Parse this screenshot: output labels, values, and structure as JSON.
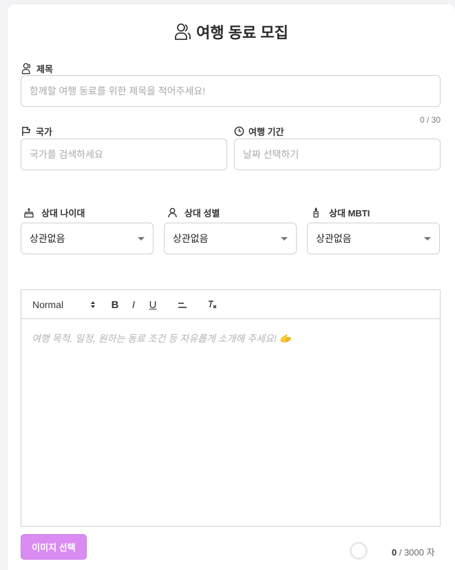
{
  "header": {
    "title": "여행 동료 모집"
  },
  "title_field": {
    "label": "제목",
    "placeholder": "함께할 여행 동료를 위한 제목을 적어주세요!",
    "counter": "0 / 30"
  },
  "country_field": {
    "label": "국가",
    "placeholder": "국가를 검색하세요"
  },
  "period_field": {
    "label": "여행 기간",
    "placeholder": "날짜 선택하기"
  },
  "age_field": {
    "label": "상대 나이대",
    "value": "상관없음"
  },
  "gender_field": {
    "label": "상대 성별",
    "value": "상관없음"
  },
  "mbti_field": {
    "label": "상대 MBTI",
    "value": "상관없음"
  },
  "editor": {
    "header_select": "Normal",
    "bold": "B",
    "italic": "I",
    "underline": "U",
    "clean": "T",
    "placeholder": "여행 목적, 일정, 원하는 동료 조건 등 자유롭게 소개해 주세요! 🫱",
    "char_count": "0",
    "char_limit": " / 3000 자"
  },
  "image_button": {
    "label": "이미지 선택"
  },
  "colors": {
    "accent": "#da8cf2",
    "border": "#cfcfd4"
  }
}
